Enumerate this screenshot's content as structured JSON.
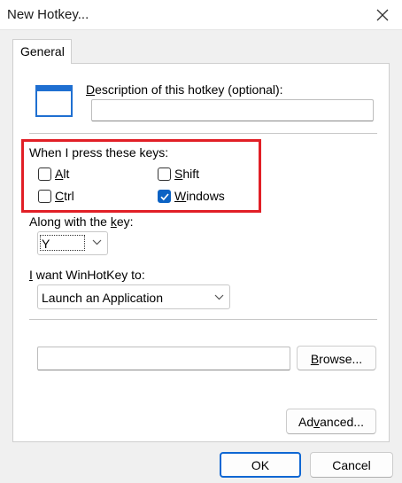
{
  "window": {
    "title": "New Hotkey...",
    "close_icon": "close-icon"
  },
  "tabs": [
    {
      "label": "General",
      "selected": true
    }
  ],
  "description": {
    "label_first": "D",
    "label_rest": "escription of this hotkey (optional):",
    "value": ""
  },
  "keys": {
    "heading": "When I press these keys:",
    "alt": {
      "accel": "A",
      "rest": "lt",
      "checked": false
    },
    "shift": {
      "accel": "S",
      "rest": "hift",
      "checked": false
    },
    "ctrl": {
      "accel": "C",
      "rest": "trl",
      "checked": false
    },
    "windows": {
      "accel": "W",
      "rest": "indows",
      "checked": true
    }
  },
  "along": {
    "label_pre": "Along with the ",
    "label_accel": "k",
    "label_post": "ey:",
    "key_value": "Y"
  },
  "action": {
    "label_accel": "I",
    "label_rest": " want WinHotKey to:",
    "value": "Launch an Application"
  },
  "path": {
    "value": ""
  },
  "buttons": {
    "browse_accel": "B",
    "browse_rest": "rowse...",
    "advanced_pre": "Ad",
    "advanced_accel": "v",
    "advanced_post": "anced...",
    "ok": "OK",
    "cancel": "Cancel"
  },
  "colors": {
    "highlight_box": "#e11f26",
    "checkbox_checked": "#0b62c4",
    "default_button_border": "#0f67d3"
  }
}
